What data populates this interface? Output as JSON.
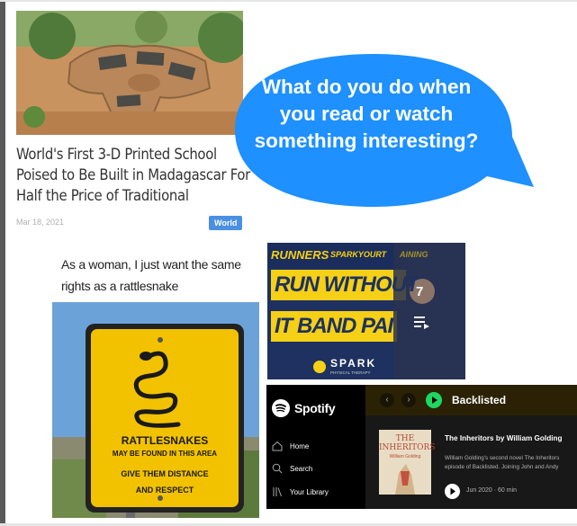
{
  "article": {
    "image_icon": "printed-school-photo",
    "title": "World's First 3-D Printed School Poised to Be Built in Madagascar For Half the Price of Traditional",
    "date": "Mar 18, 2021",
    "category": "World"
  },
  "bubble": {
    "text": "What do you do when you read or watch something interesting?",
    "color": "#1e90ff"
  },
  "meme": {
    "caption": "As a woman, I just want the same rights as a rattlesnake",
    "sign_line1": "RATTLESNAKES",
    "sign_line2": "MAY BE FOUND IN THIS AREA",
    "sign_line3": "GIVE THEM DISTANCE",
    "sign_line4": "AND RESPECT"
  },
  "video": {
    "banner_top_left": "RUNNERS",
    "banner_top_right": "SPARKYOURT",
    "banner_top_right_tail": "AINING",
    "line1": "RUN WITHOUT",
    "line2": "IT BAND PAI",
    "brand": "SPARK",
    "brand_sub": "PHYSICAL THERAPY",
    "playlist_count": "7",
    "playlist_icon": "playlist-icon"
  },
  "spotify": {
    "logo_text": "Spotify",
    "nav": [
      {
        "label": "Home",
        "icon": "home-icon"
      },
      {
        "label": "Search",
        "icon": "search-icon"
      },
      {
        "label": "Your Library",
        "icon": "library-icon"
      }
    ],
    "header_title": "Backlisted",
    "cover_title": "THE INHERITORS",
    "cover_author": "William Golding",
    "episode_title": "The Inheritors by William Golding",
    "episode_desc_line1": "William Golding's second novel The Inheritors",
    "episode_desc_line2": "episode of Backlisted. Joining John and Andy",
    "episode_meta": "Jun 2020 · 60 min",
    "accent": "#1ed760"
  }
}
